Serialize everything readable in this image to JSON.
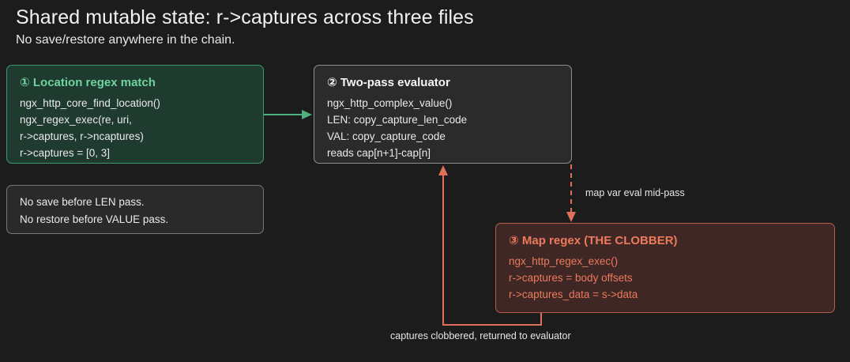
{
  "header": {
    "title": "Shared mutable state: r->captures across three files",
    "subtitle": "No save/restore anywhere in the chain."
  },
  "box_location": {
    "title": "① Location regex match",
    "lines": [
      "ngx_http_core_find_location()",
      "ngx_regex_exec(re, uri,",
      "r->captures, r->ncaptures)",
      "r->captures = [0, 3]"
    ]
  },
  "box_evaluator": {
    "title": "② Two-pass evaluator",
    "lines": [
      "ngx_http_complex_value()",
      "LEN: copy_capture_len_code",
      "VAL: copy_capture_code",
      "reads cap[n+1]-cap[n]"
    ]
  },
  "box_note": {
    "lines": [
      "No save before LEN pass.",
      "No restore before VALUE pass."
    ]
  },
  "box_map": {
    "title": "③ Map regex (THE CLOBBER)",
    "lines": [
      "ngx_http_regex_exec()",
      "r->captures = body offsets",
      "r->captures_data = s->data"
    ]
  },
  "labels": {
    "mid_pass": "map var eval mid-pass",
    "returned": "captures clobbered, returned to evaluator"
  },
  "colors": {
    "green_accent": "#3e9a6e",
    "red_accent": "#e0705a",
    "neutral_border": "#8f8f8f"
  }
}
